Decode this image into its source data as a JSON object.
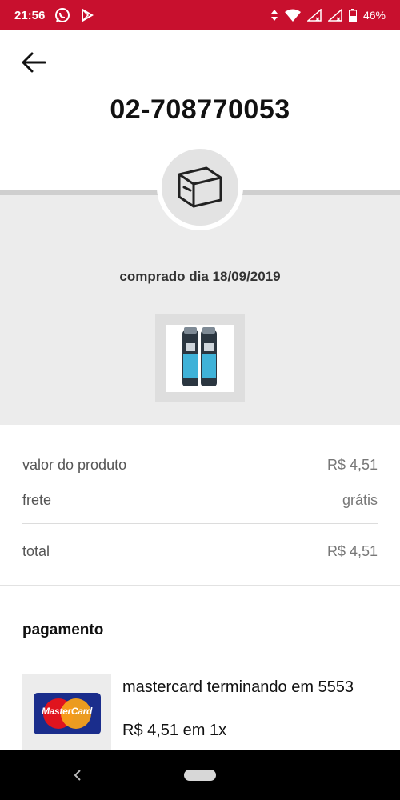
{
  "status_bar": {
    "time": "21:56",
    "battery": "46%",
    "icons": [
      "whatsapp-icon",
      "play-store-icon",
      "data-arrows-icon",
      "wifi-icon",
      "signal-icon",
      "signal-icon",
      "battery-icon"
    ]
  },
  "header": {
    "back_icon": "arrow-left-icon",
    "order_number": "02-708770053"
  },
  "order": {
    "status_icon": "box-icon",
    "purchase_date": "comprado dia 18/09/2019"
  },
  "prices": {
    "product_label": "valor do produto",
    "product_value": "R$ 4,51",
    "shipping_label": "frete",
    "shipping_value": "grátis",
    "total_label": "total",
    "total_value": "R$ 4,51"
  },
  "payment": {
    "title": "pagamento",
    "card_brand": "MasterCard",
    "card_description": "mastercard terminando em 5553",
    "card_amount": "R$ 4,51 em 1x"
  },
  "colors": {
    "status_bar": "#c8102e",
    "grey_section": "#ececec",
    "divider": "#cfcfcf"
  }
}
